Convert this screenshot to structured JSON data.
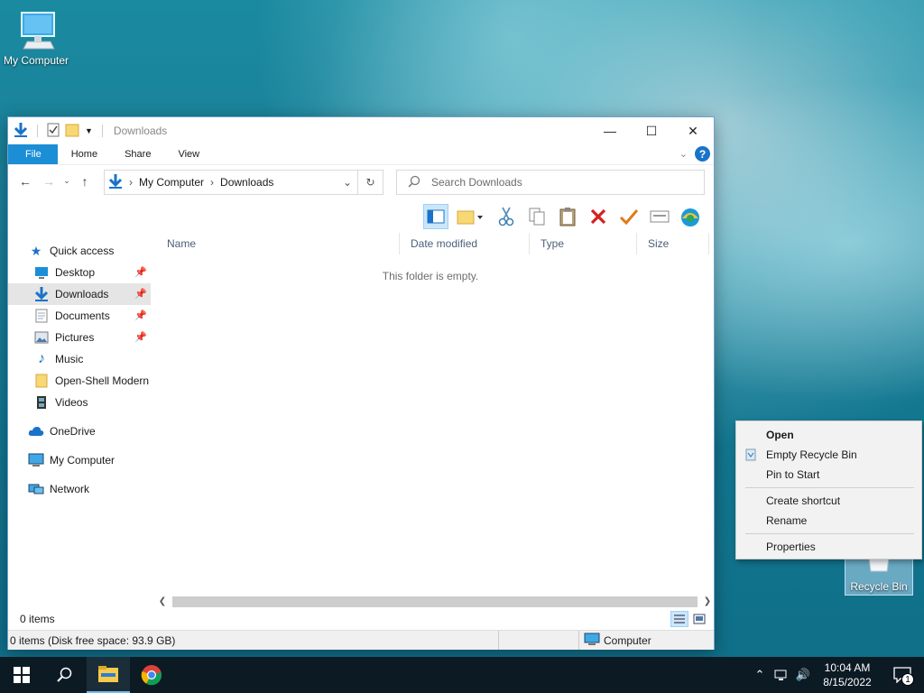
{
  "desktop": {
    "icons": {
      "my_computer": "My Computer",
      "recycle_bin": "Recycle Bin"
    }
  },
  "window": {
    "title": "Downloads",
    "tabs": [
      "File",
      "Home",
      "Share",
      "View"
    ],
    "address": {
      "crumbs": [
        "My Computer",
        "Downloads"
      ]
    },
    "search": {
      "placeholder": "Search Downloads"
    },
    "toolbar_icons": [
      "navigation-pane-icon",
      "new-folder-icon",
      "cut-icon",
      "copy-icon",
      "paste-icon",
      "delete-icon",
      "select-icon",
      "properties-icon",
      "open-shell-icon"
    ],
    "nav": {
      "quick_access": "Quick access",
      "quick_items": [
        {
          "label": "Desktop",
          "pinned": true
        },
        {
          "label": "Downloads",
          "pinned": true
        },
        {
          "label": "Documents",
          "pinned": true
        },
        {
          "label": "Pictures",
          "pinned": true
        },
        {
          "label": "Music",
          "pinned": false
        },
        {
          "label": "Open-Shell Modern",
          "pinned": false
        },
        {
          "label": "Videos",
          "pinned": false
        }
      ],
      "onedrive": "OneDrive",
      "my_computer": "My Computer",
      "network": "Network"
    },
    "columns": [
      "Name",
      "Date modified",
      "Type",
      "Size"
    ],
    "empty_message": "This folder is empty.",
    "status": {
      "items": "0 items",
      "details": "0 items (Disk free space: 93.9 GB)",
      "zone": "Computer"
    }
  },
  "context_menu": {
    "items": [
      {
        "label": "Open",
        "bold": true
      },
      {
        "label": "Empty Recycle Bin",
        "icon": "recycle-shield-icon"
      },
      {
        "label": "Pin to Start"
      },
      {
        "label": "Create shortcut"
      },
      {
        "label": "Rename"
      },
      {
        "label": "Properties"
      }
    ]
  },
  "taskbar": {
    "time": "10:04 AM",
    "date": "8/15/2022",
    "notification_count": "1"
  }
}
